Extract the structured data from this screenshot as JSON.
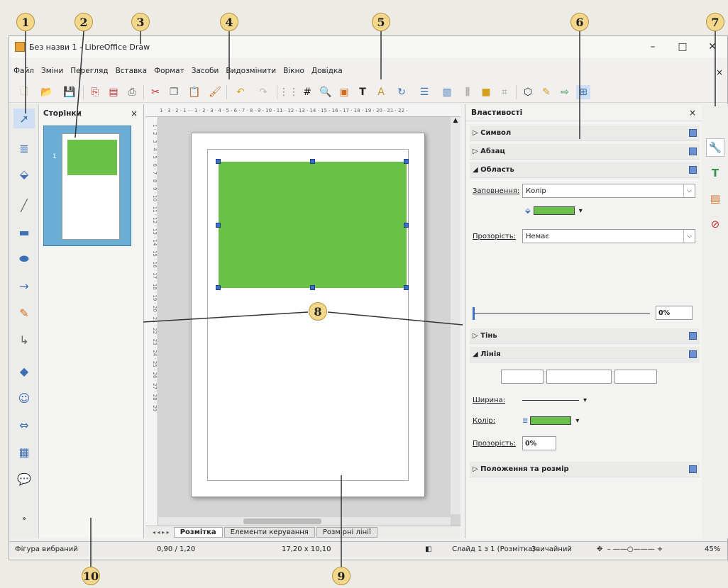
{
  "window": {
    "title": "Без назви 1 - LibreOffice Draw",
    "controls": [
      "–",
      "□",
      "✕"
    ],
    "doc_close": "×"
  },
  "menu": [
    "Файл",
    "Зміни",
    "Перегляд",
    "Вставка",
    "Формат",
    "Засоби",
    "Видозмінити",
    "Вікно",
    "Довідка"
  ],
  "toolbar_icons": [
    "new-icon",
    "open-icon",
    "save-icon",
    "export-pdf-icon",
    "print-icon",
    "cut-icon",
    "copy-icon",
    "paste-icon",
    "clone-formatting-icon",
    "undo-icon",
    "redo-icon",
    "grid-icon",
    "helplines-icon",
    "zoom-icon",
    "image-icon",
    "textbox-icon",
    "fontwork-icon",
    "rotate-icon",
    "align-icon",
    "arrange-icon",
    "distribute-icon",
    "shadow-icon",
    "crop-icon",
    "points-icon",
    "glue-icon",
    "toggle-extrusion-icon",
    "show-draw-functions-icon"
  ],
  "pages_panel": {
    "title": "Сторінки",
    "close": "×",
    "page_number": "1"
  },
  "ruler": {
    "horizontal": "1 · 3 · 2 · 1 ·  · 1 · 2 · 3 · 4 · 5 · 6 · 7 · 8 · 9 · 10 · 11 · 12 · 13 · 14 · 15 · 16 · 17 · 18 · 19 · 20 · 21 · 22 ·",
    "vertical": "1 · 2 · 3 · 4 · 5 · 6 · 7 · 8 · 9 · 10 · 11 · 12 · 13 · 14 · 15 · 16 · 17 · 18 · 19 · 20 · 21 · 22 · 23 · 24 · 25 · 26 · 27 · 28 · 29"
  },
  "tabs": [
    "Розмітка",
    "Елементи керування",
    "Розмірні лінії"
  ],
  "properties": {
    "title": "Властивості",
    "close": "×",
    "sections": {
      "symbol": "Символ",
      "paragraph": "Абзац",
      "area": "Область",
      "shadow": "Тінь",
      "line": "Лінія",
      "position": "Положення та розмір"
    },
    "fill_label": "Заповнення:",
    "fill_value": "Колір",
    "transparency_label": "Прозорість:",
    "transparency_value": "Немає",
    "transparency_percent": "0%",
    "width_label": "Ширина:",
    "color_label": "Колір:",
    "line_transparency_label": "Прозорість:",
    "line_transparency_value": "0%"
  },
  "status": {
    "selection": "Фігура вибраний",
    "position": "0,90 / 1,20",
    "size": "17,20 x 10,10",
    "slide": "Слайд 1 з 1 (Розмітка)",
    "style": "Звичайний",
    "zoom": "45%"
  },
  "callouts": [
    "1",
    "2",
    "3",
    "4",
    "5",
    "6",
    "7",
    "8",
    "9",
    "10"
  ],
  "colors": {
    "shape_fill": "#6bc048",
    "handle": "#3e6fc8",
    "callout": "#f3d78b"
  }
}
